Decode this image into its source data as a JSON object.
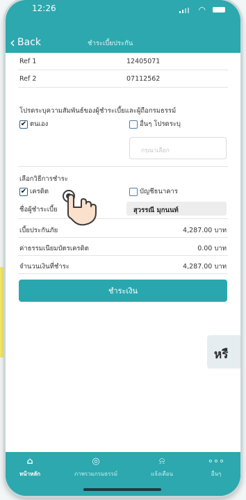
{
  "status": {
    "time": "12:26"
  },
  "nav": {
    "back": "Back",
    "title": "ชำระเบี้ยประกัน"
  },
  "refs": [
    {
      "label": "Ref 1",
      "value": "12405071"
    },
    {
      "label": "Ref 2",
      "value": "07112562"
    }
  ],
  "relationship": {
    "prompt": "โปรดระบุความสัมพันธ์ของผู้ชำระเบี้ยและผู้ถือกรมธรรม์",
    "self_label": "ตนเอง",
    "other_label": "อื่นๆ โปรดระบุ",
    "other_placeholder": "กรุณาเลือก"
  },
  "payment_method": {
    "prompt": "เลือกวิธีการชำระ",
    "credit_label": "เครดิต",
    "bank_label": "บัญชีธนาคาร"
  },
  "payer": {
    "label": "ชื่อผู้ชำระเบี้ย",
    "value": "สุวรรณี มุกนนท์"
  },
  "amounts": [
    {
      "label": "เบี้ยประกันภัย",
      "value": "4,287.00 บาท"
    },
    {
      "label": "ค่าธรรมเนียมบัตรเครดิต",
      "value": "0.00 บาท"
    },
    {
      "label": "จำนวนเงินที่ชำระ",
      "value": "4,287.00 บาท"
    }
  ],
  "pay_button": "ชำระเงิน",
  "or_text": "หรื",
  "tabs": [
    {
      "label": "หน้าหลัก",
      "icon": "home-icon"
    },
    {
      "label": "ภาพรวมกรมธรรม์",
      "icon": "shield-check-icon"
    },
    {
      "label": "แจ้งเตือน",
      "icon": "bell-icon"
    },
    {
      "label": "อื่นๆ",
      "icon": "more-dots-icon"
    }
  ],
  "colors": {
    "brand": "#2ca8ae",
    "button": "#2aa7ae",
    "highlight": "#f6e96a"
  }
}
